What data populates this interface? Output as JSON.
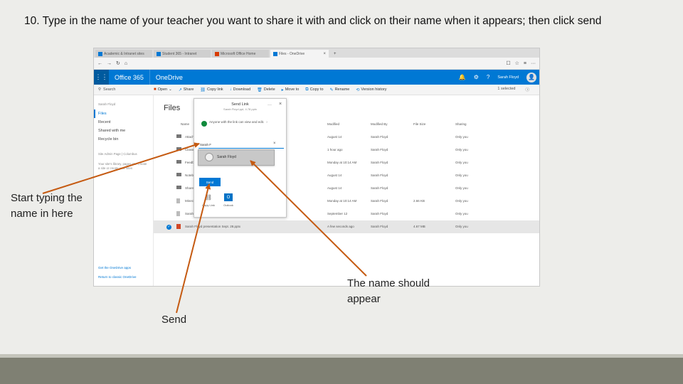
{
  "slide": {
    "title": "10. Type in the name of your teacher you want to share it with and click on their name when it appears; then click send",
    "annotations": {
      "type_name": "Start typing the name in here",
      "name_appear": "The name should appear",
      "send": "Send"
    }
  },
  "browser": {
    "tabs": [
      {
        "label": "Academic & Intranet sites"
      },
      {
        "label": "Student 365 - Intranet"
      },
      {
        "label": "Microsoft Office Home"
      },
      {
        "label": "Files - OneDrive"
      }
    ],
    "address": "",
    "colors": {
      "accent": "#0078d4",
      "office_red": "#d83b01"
    }
  },
  "suite": {
    "brand": "Office 365",
    "app": "OneDrive",
    "user": "Sarah Floyd"
  },
  "commands": {
    "search": "Search",
    "items": [
      "Open",
      "Share",
      "Copy link",
      "Download",
      "Delete",
      "Move to",
      "Copy to",
      "Rename",
      "Version history"
    ],
    "selected": "1 selected"
  },
  "nav": {
    "owner": "Sarah Floyd",
    "items": [
      "Files",
      "Recent",
      "Shared with me",
      "Recycle bin"
    ],
    "note1": "Site Admin Page | Columbus",
    "note2": "Your site's library, pages etc. Create a site or create your sites",
    "bottom1": "Get the OneDrive apps",
    "bottom2": "Return to classic OneDrive"
  },
  "files": {
    "title": "Files",
    "columns": {
      "name": "Name",
      "modified": "Modified",
      "modified_by": "Modified By",
      "size": "File Size",
      "sharing": "Sharing"
    },
    "rows": [
      {
        "name": "Attachments",
        "modified": "August 14",
        "by": "Sarah Floyd",
        "size": "",
        "sharing": "Only you"
      },
      {
        "name": "Classes",
        "modified": "1 hour ago",
        "by": "Sarah Floyd",
        "size": "",
        "sharing": "Only you"
      },
      {
        "name": "Feedback",
        "modified": "Monday at 10:14 AM",
        "by": "Sarah Floyd",
        "size": "",
        "sharing": "Only you"
      },
      {
        "name": "Notebooks",
        "modified": "August 14",
        "by": "Sarah Floyd",
        "size": "",
        "sharing": "Only you"
      },
      {
        "name": "Shared",
        "modified": "August 14",
        "by": "Sarah Floyd",
        "size": "",
        "sharing": "Only you"
      },
      {
        "name": "Minecraft",
        "modified": "Monday at 10:14 AM",
        "by": "Sarah Floyd",
        "size": "2.66 KB",
        "sharing": "Only you"
      },
      {
        "name": "Sarah",
        "modified": "September 12",
        "by": "Sarah Floyd",
        "size": "",
        "sharing": "Only you"
      },
      {
        "name": "Sarah Floyd presentation Sept. 28.pptx",
        "modified": "A few seconds ago",
        "by": "Sarah Floyd",
        "size": "4.67 MB",
        "sharing": "Only you"
      }
    ]
  },
  "dialog": {
    "title": "Send Link",
    "subtitle": "Sarah Floyd.ppt, 4.78 pptx",
    "permission": "Anyone with the link can view and edit.",
    "input_value": "Sarah F",
    "suggestion": "Sarah Floyd",
    "send_label": "Send",
    "copy_label": "Copy Link",
    "outlook_label": "Outlook"
  }
}
